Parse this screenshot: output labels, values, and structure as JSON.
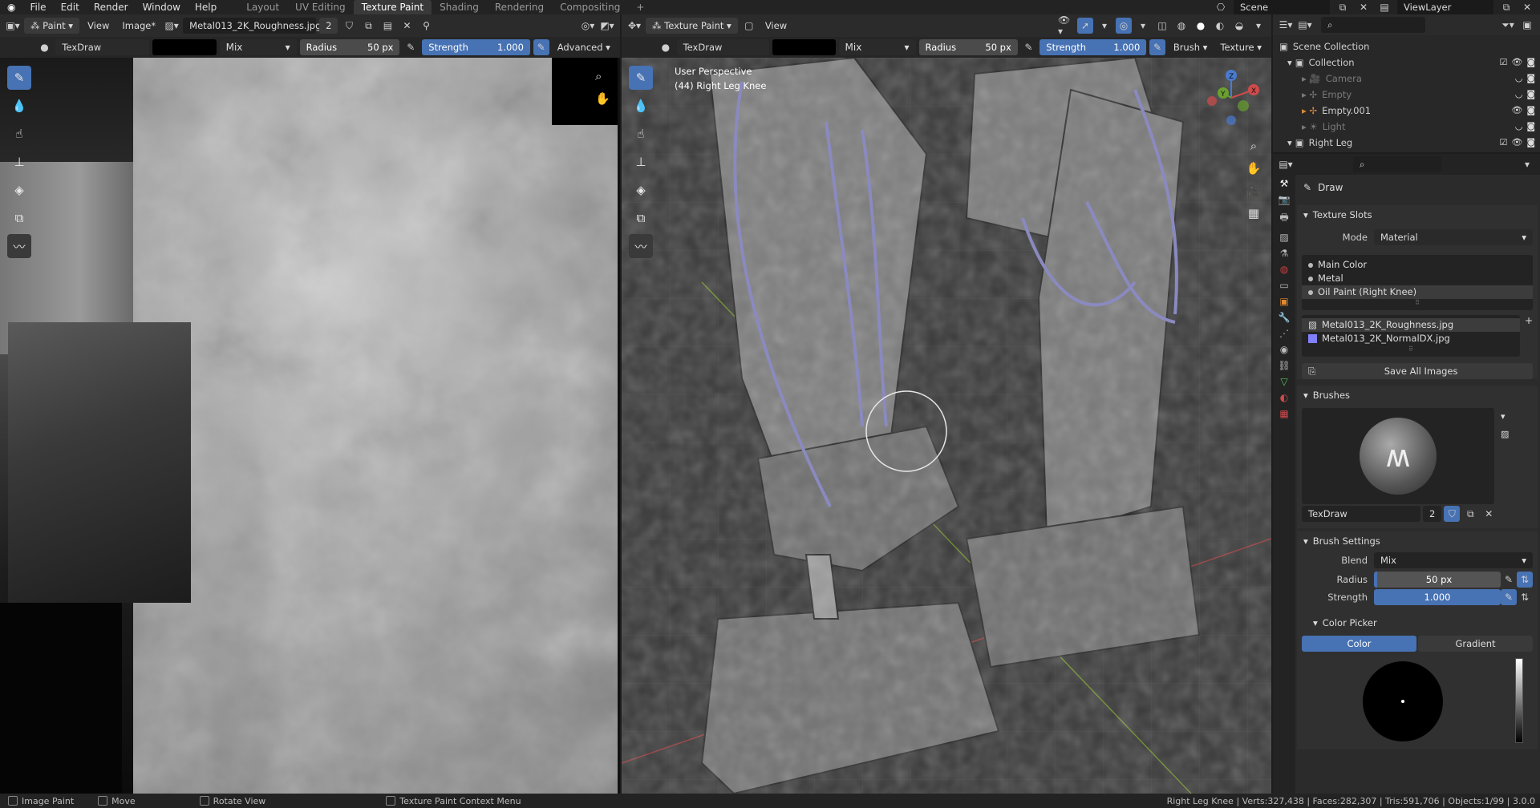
{
  "topbar": {
    "menus": [
      "File",
      "Edit",
      "Render",
      "Window",
      "Help"
    ],
    "workspaces": [
      "Layout",
      "UV Editing",
      "Texture Paint",
      "Shading",
      "Rendering",
      "Compositing"
    ],
    "active_workspace": "Texture Paint",
    "scene_label": "Scene",
    "viewlayer_label": "ViewLayer"
  },
  "image_editor": {
    "header": {
      "mode": "Paint",
      "view": "View",
      "image_menu": "Image*",
      "image_name": "Metal013_2K_Roughness.jpg",
      "users": "2"
    },
    "tool_settings": {
      "brush": "TexDraw",
      "blend": "Mix",
      "radius_label": "Radius",
      "radius_value": "50 px",
      "strength_label": "Strength",
      "strength_value": "1.000",
      "advanced": "Advanced"
    },
    "tools": [
      "draw-brush",
      "soften-brush",
      "smear-brush",
      "clone-brush",
      "fill-brush",
      "mask-brush",
      "annotate"
    ]
  },
  "viewport": {
    "header": {
      "mode": "Texture Paint",
      "view": "View"
    },
    "tool_settings": {
      "brush": "TexDraw",
      "blend": "Mix",
      "radius_label": "Radius",
      "radius_value": "50 px",
      "strength_label": "Strength",
      "strength_value": "1.000",
      "brush_menu": "Brush",
      "texture_menu": "Texture"
    },
    "overlay_text": {
      "perspective": "User Perspective",
      "object": "(44) Right Leg Knee"
    },
    "gizmo": {
      "x": "X",
      "y": "Y",
      "z": "Z"
    }
  },
  "outliner": {
    "items": [
      {
        "label": "Scene Collection",
        "level": 0
      },
      {
        "label": "Collection",
        "level": 1
      },
      {
        "label": "Camera",
        "level": 2
      },
      {
        "label": "Empty",
        "level": 2
      },
      {
        "label": "Empty.001",
        "level": 2
      },
      {
        "label": "Light",
        "level": 2
      },
      {
        "label": "Right Leg",
        "level": 1
      }
    ]
  },
  "properties": {
    "tool_name": "Draw",
    "texture_slots": {
      "title": "Texture Slots",
      "mode_label": "Mode",
      "mode_value": "Material",
      "materials": [
        "Main Color",
        "Metal",
        "Oil Paint (Right Knee)"
      ],
      "images": [
        "Metal013_2K_Roughness.jpg",
        "Metal013_2K_NormalDX.jpg"
      ],
      "save_all": "Save All Images"
    },
    "brushes": {
      "title": "Brushes",
      "brush_name": "TexDraw",
      "users": "2"
    },
    "brush_settings": {
      "title": "Brush Settings",
      "blend_label": "Blend",
      "blend_value": "Mix",
      "radius_label": "Radius",
      "radius_value": "50 px",
      "strength_label": "Strength",
      "strength_value": "1.000"
    },
    "color_picker": {
      "title": "Color Picker",
      "tab_color": "Color",
      "tab_gradient": "Gradient"
    }
  },
  "statusbar": {
    "left": [
      "Image Paint",
      "Move",
      "Rotate View",
      "Texture Paint Context Menu"
    ],
    "stats": "Right Leg Knee | Verts:327,438 | Faces:282,307 | Tris:591,706 | Objects:1/99 | 3.0.0"
  },
  "colors": {
    "accent": "#4772b3",
    "panel": "#2b2b2b",
    "background": "#1d1d1d"
  }
}
